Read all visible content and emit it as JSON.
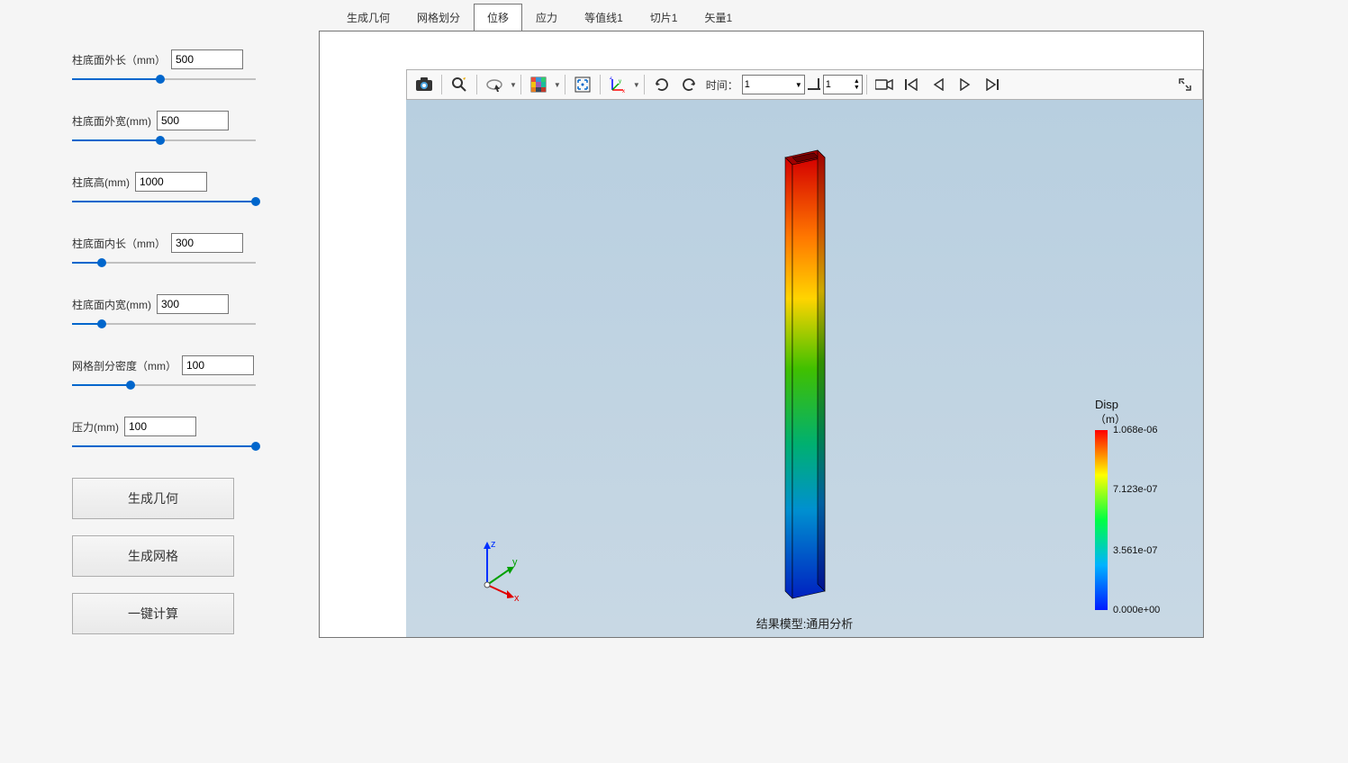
{
  "tabs": [
    {
      "label": "生成几何"
    },
    {
      "label": "网格划分"
    },
    {
      "label": "位移",
      "active": true
    },
    {
      "label": "应力"
    },
    {
      "label": "等值线1"
    },
    {
      "label": "切片1"
    },
    {
      "label": "矢量1"
    }
  ],
  "params": [
    {
      "label": "柱底面外长（mm）",
      "value": "500",
      "slider_pct": 48
    },
    {
      "label": "柱底面外宽(mm)",
      "value": "500",
      "slider_pct": 48
    },
    {
      "label": "柱底高(mm)",
      "value": "1000",
      "slider_pct": 100
    },
    {
      "label": "柱底面内长（mm）",
      "value": "300",
      "slider_pct": 16
    },
    {
      "label": "柱底面内宽(mm)",
      "value": "300",
      "slider_pct": 16
    },
    {
      "label": "网格剖分密度（mm）",
      "value": "100",
      "slider_pct": 32
    },
    {
      "label": "压力(mm)",
      "value": "100",
      "slider_pct": 100
    }
  ],
  "buttons": {
    "gen_geom": "生成几何",
    "gen_mesh": "生成网格",
    "compute": "一键计算"
  },
  "toolbar": {
    "time_label": "时间：",
    "time_value": "1",
    "step_value": "1"
  },
  "viewer": {
    "caption": "结果模型:通用分析",
    "axes": {
      "x": "x",
      "y": "y",
      "z": "z"
    }
  },
  "legend": {
    "title": "Disp",
    "unit": "（m）",
    "ticks": [
      {
        "label": "1.068e-06",
        "pos": 0
      },
      {
        "label": "7.123e-07",
        "pos": 33
      },
      {
        "label": "3.561e-07",
        "pos": 67
      },
      {
        "label": "0.000e+00",
        "pos": 100
      }
    ]
  }
}
